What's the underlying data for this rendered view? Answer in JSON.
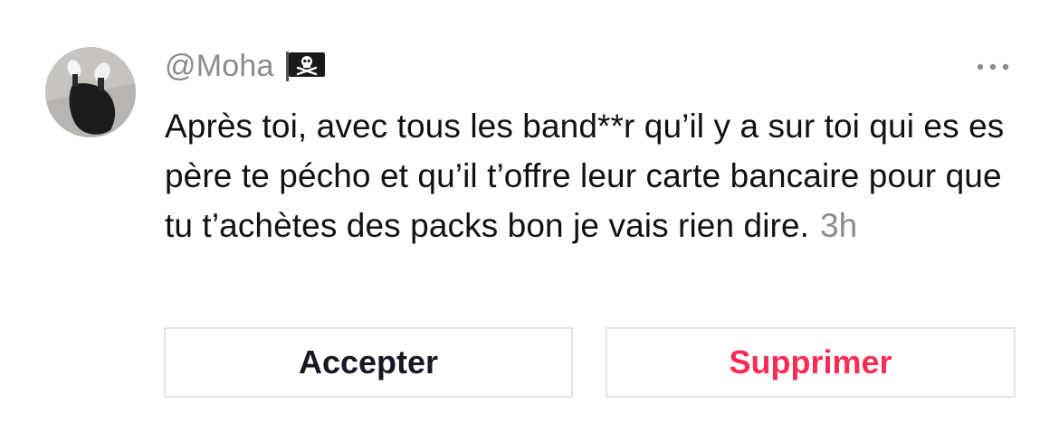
{
  "comment": {
    "avatar_icon": "user-avatar-photo",
    "username": "@Moha",
    "badge_icon": "pirate-flag-icon",
    "more_icon": "more-options-icon",
    "text": "Après toi, avec tous les band**r qu’il y a sur toi qui es espère te pécho et qu’il t’offre leur carte bancaire pour que tu t’achètes des packs bon je vais rien dire.",
    "timestamp": "3h"
  },
  "actions": {
    "accept_label": "Accepter",
    "delete_label": "Supprimer"
  },
  "colors": {
    "username": "#8a8b91",
    "text": "#111111",
    "accent_delete": "#fe2c55",
    "button_border": "#e3e3e4"
  }
}
